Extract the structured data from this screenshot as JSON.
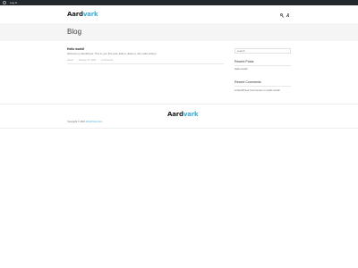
{
  "adminbar": {
    "login_label": "Log In"
  },
  "header": {
    "logo_part1": "Aard",
    "logo_part2": "vark",
    "search_icon": "search-icon",
    "user_icon": "user-icon"
  },
  "banner": {
    "title": "Blog"
  },
  "post": {
    "title": "Hello world!",
    "excerpt": "Welcome to WordPress. This is your first post. Edit or delete it, then start writing!",
    "meta_author": "admin",
    "meta_date": "January 27, 2021",
    "meta_comments": "1 Comment"
  },
  "sidebar": {
    "search_placeholder": "search",
    "recent_posts_title": "Recent Posts",
    "recent_posts": [
      "Hello world!"
    ],
    "recent_comments_title": "Recent Comments",
    "recent_comments": [
      {
        "author": "A WordPress Commenter",
        "on": "on",
        "post": "Hello world!"
      }
    ]
  },
  "footer": {
    "logo_part1": "Aard",
    "logo_part2": "vark",
    "copyright_prefix": "Copyright © 2021",
    "copyright_link": "WordPress Dev"
  },
  "colors": {
    "accent": "#3ab0d4",
    "adminbar": "#23282d",
    "banner": "#f5f5f5"
  }
}
